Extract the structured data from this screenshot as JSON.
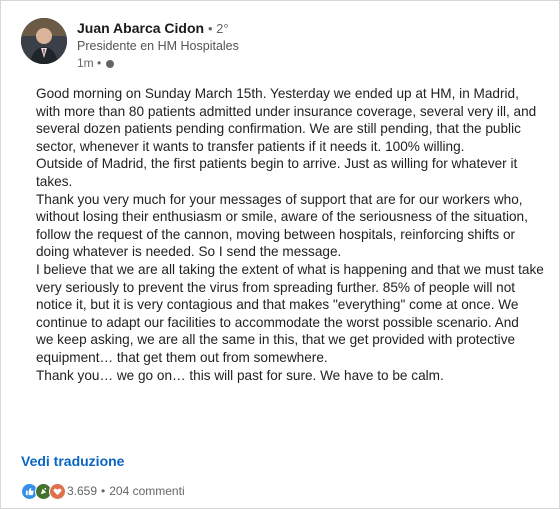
{
  "post": {
    "author": {
      "name": "Juan Abarca Cidon",
      "degree": "• 2°",
      "headline": "Presidente en HM Hospitales",
      "time": "1m •"
    },
    "lines": [
      "Good morning on Sunday March 15th.  Yesterday we ended up at HM, in Madrid,",
      "with more than 80 patients admitted under insurance coverage, several very ill, and",
      "several dozen patients pending confirmation.  We are still pending, that the public",
      "sector, whenever it wants to transfer patients if it needs it.  100% willing.",
      "Outside of Madrid, the first patients begin to arrive.  Just as willing for whatever it",
      "takes.",
      "Thank you very much for your messages of support that are for our workers who,",
      "without losing their enthusiasm or smile, aware of the seriousness of the situation,",
      "follow the request of the cannon, moving between hospitals, reinforcing shifts or",
      "doing whatever is needed.  So I send the message.",
      "I believe that we are all taking the extent of what is happening and that we must take",
      "very seriously to prevent the virus from spreading further.  85% of people will not",
      "notice it, but it is very contagious and that makes \"everything\" come at once.  We",
      "continue to adapt our facilities to accommodate the worst possible scenario.  And",
      "we keep asking, we are all the same in this, that we get provided with protective",
      "equipment… that get them out from somewhere.",
      "Thank you… we go on… this will past for sure.  We have to be calm."
    ],
    "translate_label": "Vedi traduzione",
    "reactions_count": "3.659",
    "separator": "•",
    "comments_label": "204 commenti",
    "reaction_icons": [
      "like-icon",
      "celebrate-icon",
      "love-icon"
    ]
  },
  "colors": {
    "link": "#0a66c2",
    "like": "#378fe9",
    "celebrate": "#44712e",
    "love": "#df704d"
  }
}
